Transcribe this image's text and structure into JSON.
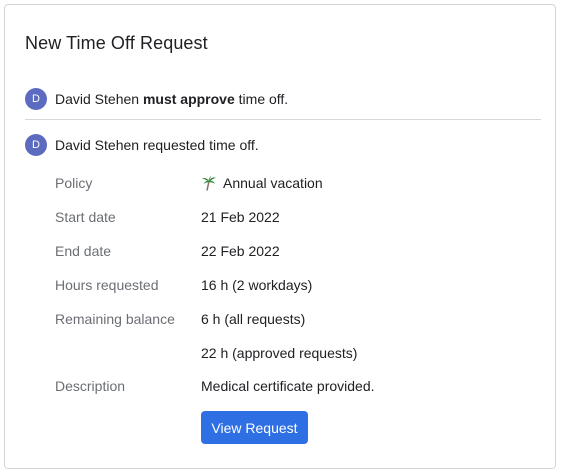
{
  "card": {
    "title": "New Time Off Request"
  },
  "approval_message": {
    "avatar_letter": "D",
    "name": "David Stehen",
    "action": "must approve",
    "suffix": "time off."
  },
  "request_message": {
    "avatar_letter": "D",
    "text": "David Stehen requested time off."
  },
  "details": {
    "policy_label": "Policy",
    "policy_icon": "palm-tree-icon",
    "policy_value": "Annual vacation",
    "start_label": "Start date",
    "start_value": "21 Feb 2022",
    "end_label": "End date",
    "end_value": "22 Feb 2022",
    "hours_label": "Hours requested",
    "hours_value": "16 h (2 workdays)",
    "balance_label": "Remaining balance",
    "balance_all": "6 h (all requests)",
    "balance_approved": "22 h (approved requests)",
    "description_label": "Description",
    "description_value": "Medical certificate provided."
  },
  "actions": {
    "view_request": "View Request"
  },
  "colors": {
    "avatar": "#5c6bc0",
    "button": "#2f6fe4",
    "label": "#6b6f74",
    "palm_leaves": "#2e7d32",
    "palm_trunk": "#8d6e63"
  }
}
